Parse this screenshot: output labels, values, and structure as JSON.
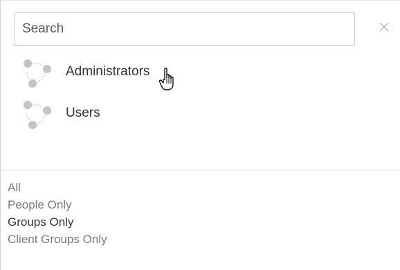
{
  "search": {
    "placeholder": "Search",
    "value": ""
  },
  "close": {
    "icon": "close-icon",
    "glyph": "×"
  },
  "results": [
    {
      "label": "Administrators",
      "icon": "group-icon"
    },
    {
      "label": "Users",
      "icon": "group-icon"
    }
  ],
  "filters": [
    {
      "label": "All",
      "active": false
    },
    {
      "label": "People Only",
      "active": false
    },
    {
      "label": "Groups Only",
      "active": true
    },
    {
      "label": "Client Groups Only",
      "active": false
    }
  ],
  "colors": {
    "icon_gray": "#c4c4c4",
    "text": "#333333",
    "muted_text": "#7b7b7b",
    "border": "#c9c9c9"
  }
}
